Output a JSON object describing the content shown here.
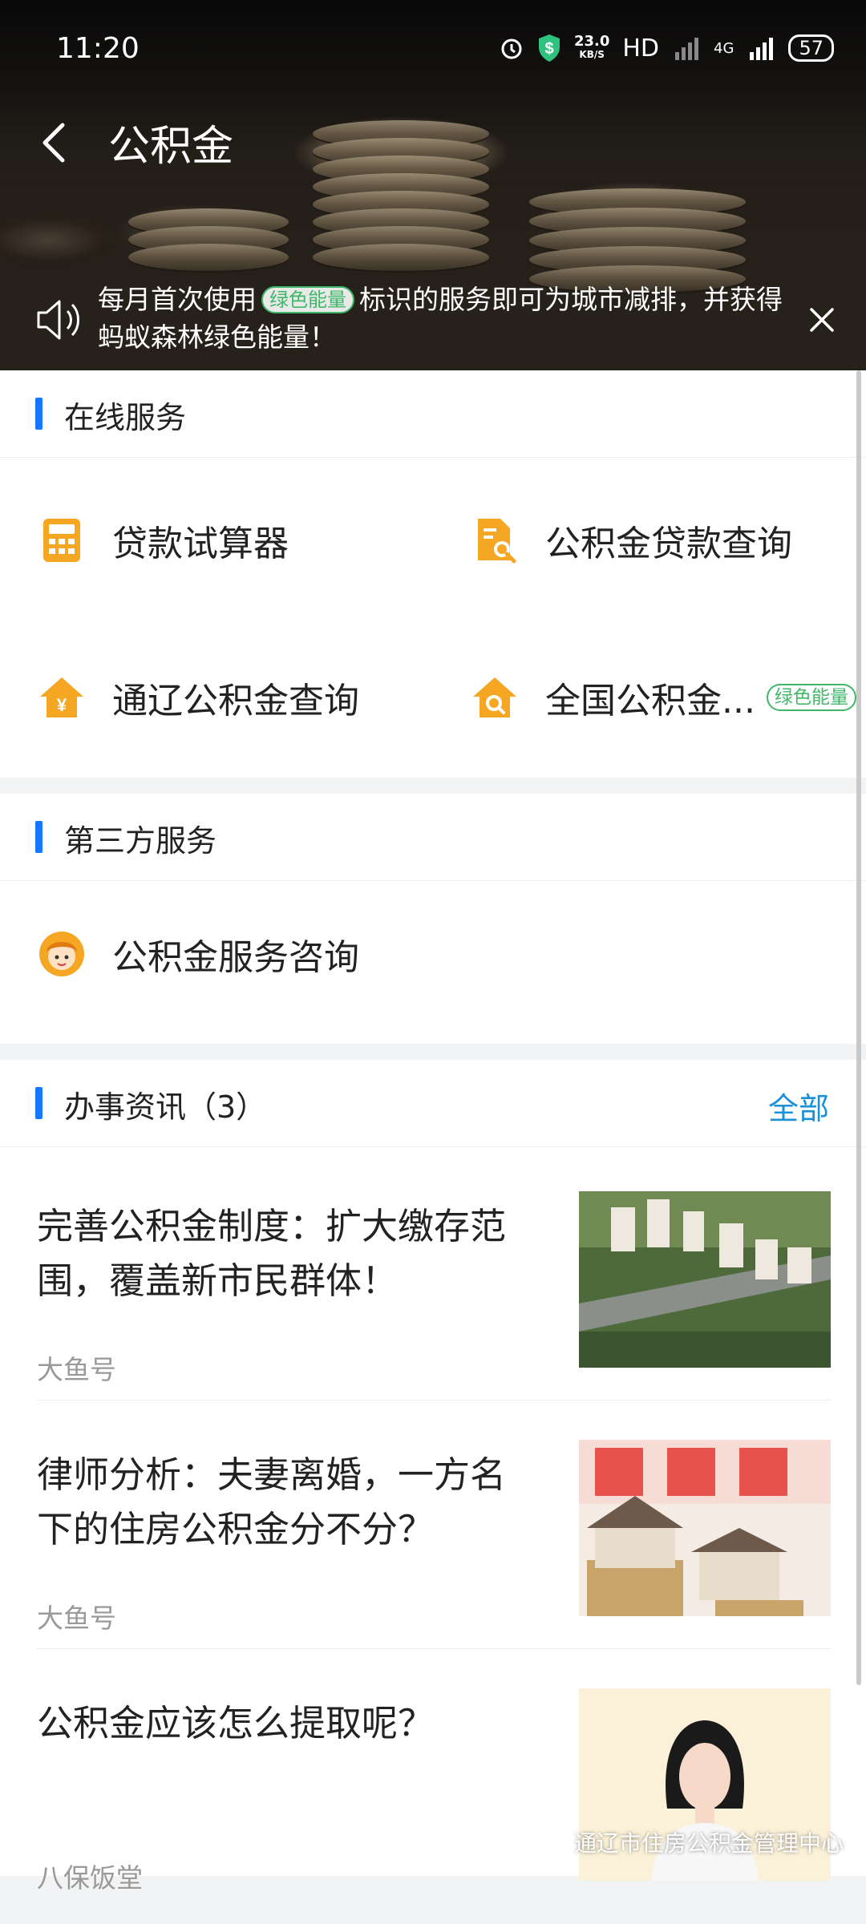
{
  "status": {
    "time": "11:20",
    "speed_value": "23.0",
    "speed_unit": "KB/S",
    "hd": "HD",
    "network": "4G",
    "battery": "57"
  },
  "header": {
    "title": "公积金"
  },
  "notice": {
    "text_before": "每月首次使用",
    "badge": "绿色能量",
    "text_after": "标识的服务即可为城市减排，并获得蚂蚁森林绿色能量！"
  },
  "online_services": {
    "title": "在线服务",
    "items": [
      {
        "label": "贷款试算器",
        "icon": "calculator-icon"
      },
      {
        "label": "公积金贷款查询",
        "icon": "document-search-icon"
      },
      {
        "label": "通辽公积金查询",
        "icon": "house-yen-icon"
      },
      {
        "label": "全国公积金...",
        "icon": "house-search-icon",
        "badge": "绿色能量"
      }
    ]
  },
  "third_party": {
    "title": "第三方服务",
    "items": [
      {
        "label": "公积金服务咨询",
        "icon": "advisor-avatar-icon"
      }
    ]
  },
  "news": {
    "title": "办事资讯（3）",
    "more_label": "全部",
    "items": [
      {
        "title": "完善公积金制度：扩大缴存范围，覆盖新市民群体！",
        "source": "大鱼号"
      },
      {
        "title": "律师分析：夫妻离婚，一方名下的住房公积金分不分？",
        "source": "大鱼号"
      },
      {
        "title": "公积金应该怎么提取呢？",
        "source": "八保饭堂"
      }
    ]
  },
  "watermark": "通辽市住房公积金管理中心",
  "colors": {
    "accent_blue": "#1677ff",
    "link_blue": "#1a90d8",
    "icon_orange": "#f5a623",
    "green_energy": "#3fb86a"
  }
}
